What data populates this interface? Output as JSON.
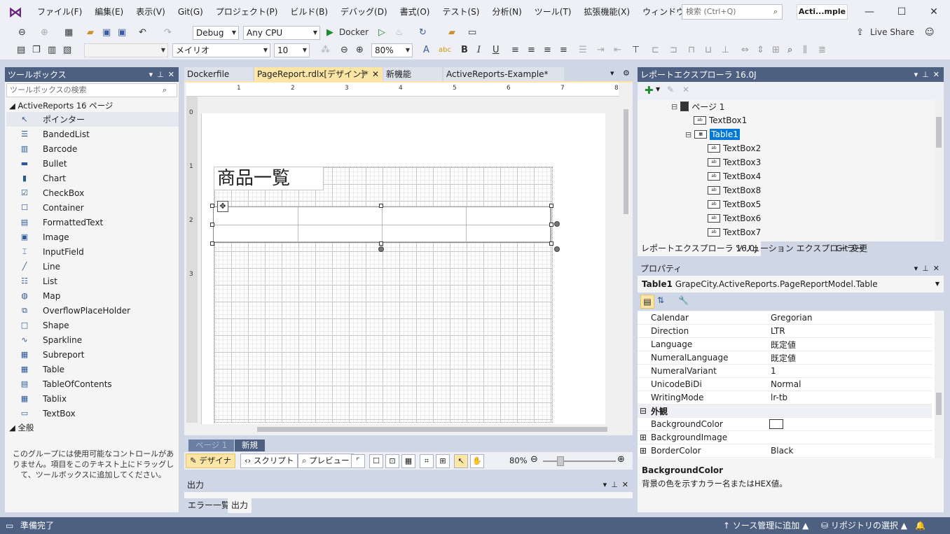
{
  "menu": [
    "ファイル(F)",
    "編集(E)",
    "表示(V)",
    "Git(G)",
    "プロジェクト(P)",
    "ビルド(B)",
    "デバッグ(D)",
    "書式(O)",
    "テスト(S)",
    "分析(N)",
    "ツール(T)",
    "拡張機能(X)",
    "ウィンドウ(W)",
    "ヘルプ(H)"
  ],
  "search_placeholder": "検索 (Ctrl+Q)",
  "solution_title": "Acti...mple",
  "live_share": "Live Share",
  "toolbar": {
    "config": "Debug",
    "platform": "Any CPU",
    "run_target": "Docker",
    "font_name": "メイリオ",
    "font_size": "10",
    "zoom": "80%",
    "bold": "B",
    "italic": "I",
    "underline": "U"
  },
  "toolbox": {
    "title": "ツールボックス",
    "search_placeholder": "ツールボックスの検索",
    "group1": "ActiveReports 16 ページ",
    "items": [
      {
        "label": "ポインター",
        "icon": "pointer-icon"
      },
      {
        "label": "BandedList",
        "icon": "bandedlist-icon"
      },
      {
        "label": "Barcode",
        "icon": "barcode-icon"
      },
      {
        "label": "Bullet",
        "icon": "bullet-icon"
      },
      {
        "label": "Chart",
        "icon": "chart-icon"
      },
      {
        "label": "CheckBox",
        "icon": "checkbox-icon"
      },
      {
        "label": "Container",
        "icon": "container-icon"
      },
      {
        "label": "FormattedText",
        "icon": "formattedtext-icon"
      },
      {
        "label": "Image",
        "icon": "image-icon"
      },
      {
        "label": "InputField",
        "icon": "inputfield-icon"
      },
      {
        "label": "Line",
        "icon": "line-icon"
      },
      {
        "label": "List",
        "icon": "list-icon"
      },
      {
        "label": "Map",
        "icon": "map-icon"
      },
      {
        "label": "OverflowPlaceHolder",
        "icon": "overflowplaceholder-icon"
      },
      {
        "label": "Shape",
        "icon": "shape-icon"
      },
      {
        "label": "Sparkline",
        "icon": "sparkline-icon"
      },
      {
        "label": "Subreport",
        "icon": "subreport-icon"
      },
      {
        "label": "Table",
        "icon": "table-icon"
      },
      {
        "label": "TableOfContents",
        "icon": "tableofcontents-icon"
      },
      {
        "label": "Tablix",
        "icon": "tablix-icon"
      },
      {
        "label": "TextBox",
        "icon": "textbox-icon"
      }
    ],
    "group2": "全般",
    "hint": "このグループには使用可能なコントロールがありません。項目をこのテキスト上にドラッグして、ツールボックスに追加してください。"
  },
  "doc_tabs": [
    "Dockerfile",
    "PageReport.rdlx[デザイン]*",
    "新機能",
    "ActiveReports-Example*"
  ],
  "ruler_h": [
    "1",
    "2",
    "3",
    "4",
    "5",
    "6",
    "7",
    "8"
  ],
  "ruler_v": [
    "0",
    "1",
    "2",
    "3"
  ],
  "report_title": "商品一覧",
  "page_tabs": [
    "ページ 1",
    "新規"
  ],
  "designer_bar": {
    "design": "デザイナ",
    "script": "スクリプト",
    "preview": "プレビュー",
    "zoom": "80%"
  },
  "output": {
    "title": "出力",
    "tabs": [
      "エラー一覧",
      "出力"
    ]
  },
  "report_explorer": {
    "title": "レポートエクスプローラ 16.0J",
    "nodes": [
      {
        "label": "ページ 1",
        "level": 0
      },
      {
        "label": "TextBox1",
        "level": 1
      },
      {
        "label": "Table1",
        "level": 1
      },
      {
        "label": "TextBox2",
        "level": 2
      },
      {
        "label": "TextBox3",
        "level": 2
      },
      {
        "label": "TextBox4",
        "level": 2
      },
      {
        "label": "TextBox8",
        "level": 2
      },
      {
        "label": "TextBox5",
        "level": 2
      },
      {
        "label": "TextBox6",
        "level": 2
      },
      {
        "label": "TextBox7",
        "level": 2
      }
    ],
    "tabs": [
      "レポートエクスプローラ 16.0J",
      "ソリューション エクスプローラー",
      "Git 変更"
    ]
  },
  "properties": {
    "title": "プロパティ",
    "object_name": "Table1",
    "object_type": "GrapeCity.ActiveReports.PageReportModel.Table",
    "rows": [
      {
        "name": "Calendar",
        "value": "Gregorian"
      },
      {
        "name": "Direction",
        "value": "LTR"
      },
      {
        "name": "Language",
        "value": "既定値"
      },
      {
        "name": "NumeralLanguage",
        "value": "既定値"
      },
      {
        "name": "NumeralVariant",
        "value": "1"
      },
      {
        "name": "UnicodeBiDi",
        "value": "Normal"
      },
      {
        "name": "WritingMode",
        "value": "lr-tb"
      }
    ],
    "category": "外観",
    "rows2": [
      {
        "name": "BackgroundColor",
        "value": ""
      },
      {
        "name": "BackgroundImage",
        "value": ""
      },
      {
        "name": "BorderColor",
        "value": "Black"
      }
    ],
    "desc_title": "BackgroundColor",
    "desc_text": "背景の色を示すカラー名またはHEX値。"
  },
  "status": {
    "ready": "準備完了",
    "scm": "ソース管理に追加",
    "repo": "リポジトリの選択"
  }
}
